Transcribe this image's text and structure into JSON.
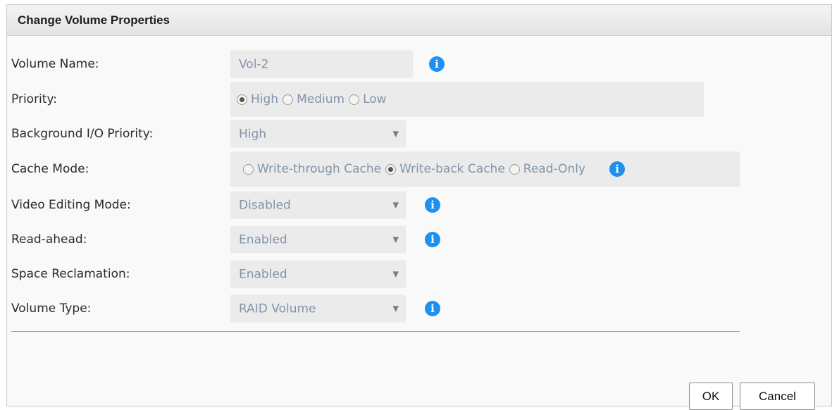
{
  "dialog": {
    "title": "Change Volume Properties"
  },
  "form": {
    "volume_name": {
      "label": "Volume Name:",
      "value": "Vol-2"
    },
    "priority": {
      "label": "Priority:",
      "options": [
        "High",
        "Medium",
        "Low"
      ],
      "selected": "High"
    },
    "bg_io_priority": {
      "label": "Background I/O Priority:",
      "value": "High"
    },
    "cache_mode": {
      "label": "Cache Mode:",
      "options": [
        "Write-through Cache",
        "Write-back Cache",
        "Read-Only"
      ],
      "selected": "Write-back Cache"
    },
    "video_editing_mode": {
      "label": "Video Editing Mode:",
      "value": "Disabled"
    },
    "read_ahead": {
      "label": "Read-ahead:",
      "value": "Enabled"
    },
    "space_reclamation": {
      "label": "Space Reclamation:",
      "value": "Enabled"
    },
    "volume_type": {
      "label": "Volume Type:",
      "value": "RAID Volume"
    }
  },
  "icons": {
    "info": "info-icon",
    "dropdown": "dropdown-arrow-icon"
  },
  "buttons": {
    "ok": "OK",
    "cancel": "Cancel"
  },
  "colors": {
    "info_icon": "#1e90f0",
    "field_bg": "#ebebeb",
    "field_text": "#8494a8"
  }
}
